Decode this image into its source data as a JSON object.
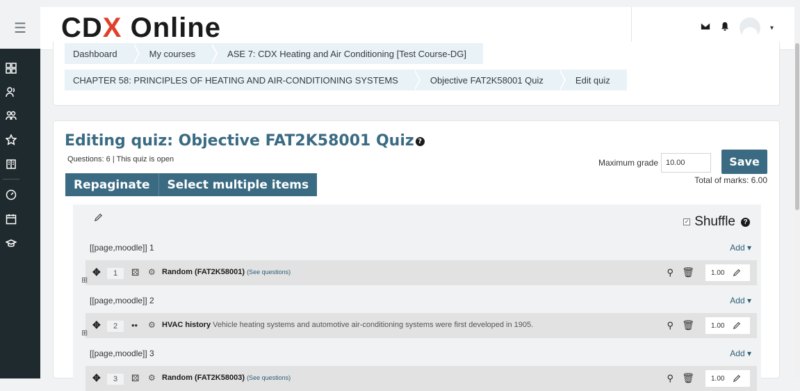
{
  "sidebar": {
    "items": [
      {
        "icon": "hamburger-icon"
      },
      {
        "icon": "dashboard-grid-icon"
      },
      {
        "icon": "user-group-icon"
      },
      {
        "icon": "users-icon"
      },
      {
        "icon": "star-icon"
      },
      {
        "icon": "book-icon"
      },
      {
        "icon": "speedometer-icon"
      },
      {
        "icon": "calendar-icon"
      },
      {
        "icon": "graduation-cap-icon"
      }
    ]
  },
  "header": {
    "logo_cdx": "CDX",
    "logo_online": "Online"
  },
  "breadcrumbs": {
    "row1": [
      "Dashboard",
      "My courses",
      "ASE 7: CDX Heating and Air Conditioning [Test Course-DG]"
    ],
    "row2": [
      "CHAPTER 58: PRINCIPLES OF HEATING AND AIR-CONDITIONING SYSTEMS",
      "Objective FAT2K58001 Quiz",
      "Edit quiz"
    ]
  },
  "quiz": {
    "title": "Editing quiz: Objective FAT2K58001 Quiz",
    "status": "Questions: 6 | This quiz is open",
    "max_grade_label": "Maximum grade",
    "max_grade_value": "10.00",
    "save_label": "Save",
    "total_marks": "Total of marks: 6.00",
    "repaginate_label": "Repaginate",
    "select_multiple_label": "Select multiple items",
    "shuffle_label": "Shuffle",
    "add_label": "Add ▾"
  },
  "pages": [
    {
      "label": "[[page,moodle]] 1",
      "question": {
        "number": "1",
        "name": "Random (FAT2K58001)",
        "desc": "",
        "link": "(See questions)",
        "mark": "1.00"
      }
    },
    {
      "label": "[[page,moodle]] 2",
      "question": {
        "number": "2",
        "name": "HVAC history",
        "desc": "Vehicle heating systems and automotive air-conditioning systems were first developed in 1905.",
        "link": "",
        "mark": "1.00"
      }
    },
    {
      "label": "[[page,moodle]] 3",
      "question": {
        "number": "3",
        "name": "Random (FAT2K58003)",
        "desc": "",
        "link": "(See questions)",
        "mark": "1.00"
      }
    }
  ]
}
